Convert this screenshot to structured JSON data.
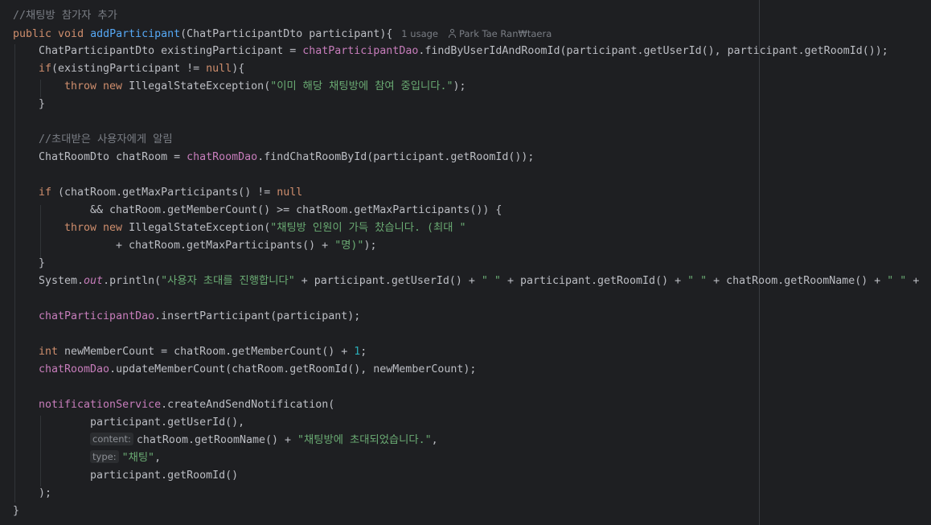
{
  "editor": {
    "lines": [
      {
        "indent": 16,
        "segments": [
          {
            "t": "//채팅방 참가자 추가",
            "c": "cm"
          }
        ]
      },
      {
        "indent": 16,
        "segments": [
          {
            "t": "public ",
            "c": "kw"
          },
          {
            "t": "void ",
            "c": "kw"
          },
          {
            "t": "addParticipant",
            "c": "fn"
          },
          {
            "t": "(ChatParticipantDto participant){",
            "c": ""
          },
          {
            "t": "   1 usage",
            "c": "meta"
          },
          {
            "icon": "person-icon"
          },
          {
            "t": "Park Tae Ran₩taera",
            "c": "meta"
          }
        ]
      },
      {
        "indent": 48,
        "segments": [
          {
            "t": "ChatParticipantDto existingParticipant = ",
            "c": ""
          },
          {
            "t": "chatParticipantDao",
            "c": "field"
          },
          {
            "t": ".findByUserIdAndRoomId(participant.getUserId(), participant.getRoomId());",
            "c": ""
          }
        ]
      },
      {
        "indent": 48,
        "segments": [
          {
            "t": "if",
            "c": "kw"
          },
          {
            "t": "(existingParticipant != ",
            "c": ""
          },
          {
            "t": "null",
            "c": "kw"
          },
          {
            "t": "){",
            "c": ""
          }
        ]
      },
      {
        "indent": 80,
        "segments": [
          {
            "t": "throw ",
            "c": "kw"
          },
          {
            "t": "new ",
            "c": "kw"
          },
          {
            "t": "IllegalStateException(",
            "c": ""
          },
          {
            "t": "\"이미 해당 채팅방에 참여 중입니다.\"",
            "c": "str"
          },
          {
            "t": ");",
            "c": ""
          }
        ]
      },
      {
        "indent": 48,
        "segments": [
          {
            "t": "}",
            "c": ""
          }
        ]
      },
      {
        "indent": 48,
        "segments": []
      },
      {
        "indent": 48,
        "segments": [
          {
            "t": "//초대받은 사용자에게 알림",
            "c": "cm"
          }
        ]
      },
      {
        "indent": 48,
        "segments": [
          {
            "t": "ChatRoomDto chatRoom = ",
            "c": ""
          },
          {
            "t": "chatRoomDao",
            "c": "field"
          },
          {
            "t": ".findChatRoomById(participant.getRoomId());",
            "c": ""
          }
        ]
      },
      {
        "indent": 48,
        "segments": []
      },
      {
        "indent": 48,
        "segments": [
          {
            "t": "if ",
            "c": "kw"
          },
          {
            "t": "(chatRoom.getMaxParticipants() != ",
            "c": ""
          },
          {
            "t": "null",
            "c": "kw"
          }
        ]
      },
      {
        "indent": 112,
        "segments": [
          {
            "t": "&& chatRoom.getMemberCount() >= chatRoom.getMaxParticipants()) {",
            "c": ""
          }
        ]
      },
      {
        "indent": 80,
        "segments": [
          {
            "t": "throw ",
            "c": "kw"
          },
          {
            "t": "new ",
            "c": "kw"
          },
          {
            "t": "IllegalStateException(",
            "c": ""
          },
          {
            "t": "\"채팅방 인원이 가득 찼습니다. (최대 \"",
            "c": "str"
          }
        ]
      },
      {
        "indent": 144,
        "segments": [
          {
            "t": "+ chatRoom.getMaxParticipants() + ",
            "c": ""
          },
          {
            "t": "\"명)\"",
            "c": "str"
          },
          {
            "t": ");",
            "c": ""
          }
        ]
      },
      {
        "indent": 48,
        "segments": [
          {
            "t": "}",
            "c": ""
          }
        ]
      },
      {
        "indent": 48,
        "segments": [
          {
            "t": "System.",
            "c": ""
          },
          {
            "t": "out",
            "c": "static"
          },
          {
            "t": ".println(",
            "c": ""
          },
          {
            "t": "\"사용자 초대를 진행합니다\"",
            "c": "str"
          },
          {
            "t": " + participant.getUserId() + ",
            "c": ""
          },
          {
            "t": "\" \"",
            "c": "str"
          },
          {
            "t": " + participant.getRoomId() + ",
            "c": ""
          },
          {
            "t": "\" \"",
            "c": "str"
          },
          {
            "t": " + chatRoom.getRoomName() + ",
            "c": ""
          },
          {
            "t": "\" \"",
            "c": "str"
          },
          {
            "t": " +",
            "c": ""
          }
        ]
      },
      {
        "indent": 48,
        "segments": []
      },
      {
        "indent": 48,
        "segments": [
          {
            "t": "chatParticipantDao",
            "c": "field"
          },
          {
            "t": ".insertParticipant(participant);",
            "c": ""
          }
        ]
      },
      {
        "indent": 48,
        "segments": []
      },
      {
        "indent": 48,
        "segments": [
          {
            "t": "int ",
            "c": "kw"
          },
          {
            "t": "newMemberCount = chatRoom.getMemberCount() + ",
            "c": ""
          },
          {
            "t": "1",
            "c": "num"
          },
          {
            "t": ";",
            "c": ""
          }
        ]
      },
      {
        "indent": 48,
        "segments": [
          {
            "t": "chatRoomDao",
            "c": "field"
          },
          {
            "t": ".updateMemberCount(chatRoom.getRoomId(), newMemberCount);",
            "c": ""
          }
        ]
      },
      {
        "indent": 48,
        "segments": []
      },
      {
        "indent": 48,
        "segments": [
          {
            "t": "notificationService",
            "c": "field"
          },
          {
            "t": ".createAndSendNotification(",
            "c": ""
          }
        ]
      },
      {
        "indent": 112,
        "segments": [
          {
            "t": "participant.getUserId(),",
            "c": ""
          }
        ]
      },
      {
        "indent": 112,
        "segments": [
          {
            "hint": "content:"
          },
          {
            "t": "chatRoom.getRoomName() + ",
            "c": ""
          },
          {
            "t": "\"채팅방에 초대되었습니다.\"",
            "c": "str"
          },
          {
            "t": ",",
            "c": ""
          }
        ]
      },
      {
        "indent": 112,
        "segments": [
          {
            "hint": "type:"
          },
          {
            "t": "\"채팅\"",
            "c": "str"
          },
          {
            "t": ",",
            "c": ""
          }
        ]
      },
      {
        "indent": 112,
        "segments": [
          {
            "t": "participant.getRoomId()",
            "c": ""
          }
        ]
      },
      {
        "indent": 48,
        "segments": [
          {
            "t": ");",
            "c": ""
          }
        ]
      },
      {
        "indent": 16,
        "segments": [
          {
            "t": "}",
            "c": ""
          }
        ]
      }
    ]
  }
}
